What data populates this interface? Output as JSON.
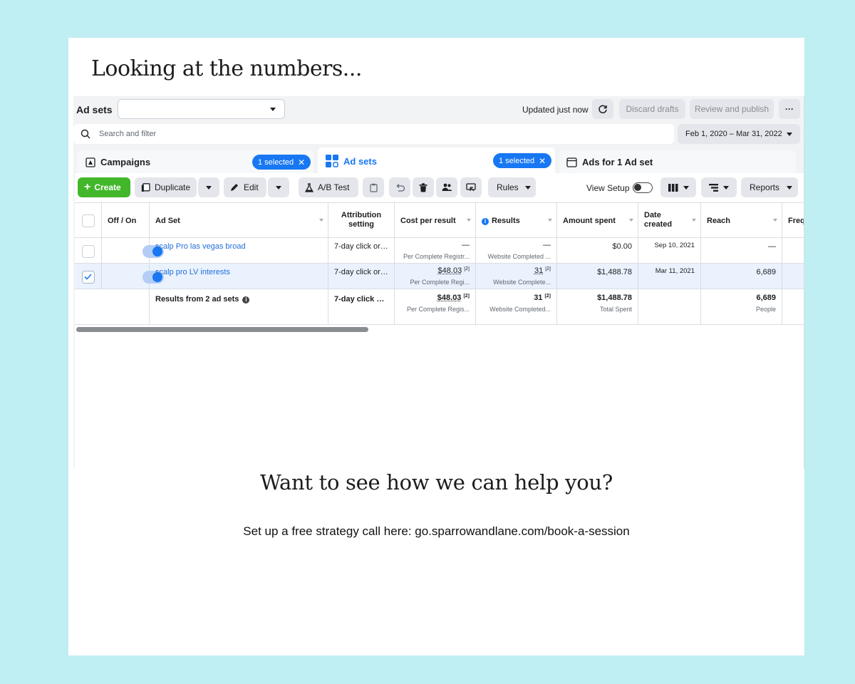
{
  "headline": "Looking at the numbers...",
  "ads_manager": {
    "level_title": "Ad sets",
    "status_text": "Updated just now",
    "discard_label": "Discard drafts",
    "review_label": "Review and publish",
    "more_label": "···",
    "search_placeholder": "Search and filter",
    "date_range": "Feb 1, 2020 – Mar 31, 2022",
    "tabs": [
      {
        "label": "Campaigns",
        "badge": "1 selected"
      },
      {
        "label": "Ad sets",
        "badge": "1 selected"
      },
      {
        "label": "Ads for 1 Ad set"
      }
    ],
    "toolbar": {
      "create_label": "Create",
      "duplicate_label": "Duplicate",
      "edit_label": "Edit",
      "abtest_label": "A/B Test",
      "rules_label": "Rules",
      "view_setup_label": "View Setup",
      "reports_label": "Reports"
    },
    "columns": {
      "off_on": "Off / On",
      "ad_set": "Ad Set",
      "attribution": "Attribution setting",
      "cost_per_result": "Cost per result",
      "results": "Results",
      "amount_spent": "Amount spent",
      "date_created": "Date created",
      "reach": "Reach",
      "frequency": "Frequency"
    },
    "rows": [
      {
        "name": "scalp Pro las vegas broad",
        "attribution": "7-day click or ...",
        "cost": "—",
        "cost_sub": "Per Complete Registr...",
        "results": "—",
        "results_sub": "Website Completed ...",
        "spent": "$0.00",
        "date": "Sep 10, 2021",
        "reach": "—",
        "selected": false,
        "on": true
      },
      {
        "name": "scalp pro LV interests",
        "attribution": "7-day click or ...",
        "cost": "$48.03",
        "cost_sub": "Per Complete Regi...",
        "results": "31",
        "results_sub": "Website Complete...",
        "spent": "$1,488.78",
        "date": "Mar 11, 2021",
        "reach": "6,689",
        "selected": true,
        "on": true
      }
    ],
    "summary": {
      "label": "Results from 2 ad sets",
      "attribution": "7-day click or ...",
      "cost": "$48.03",
      "cost_sub": "Per Complete Regis...",
      "results": "31",
      "results_sub": "Website Completed...",
      "spent": "$1,488.78",
      "spent_sub": "Total Spent",
      "reach": "6,689",
      "reach_sub": "People"
    },
    "footnote_marker": "[2]"
  },
  "cta": {
    "title": "Want to see how we can help you?",
    "subtitle": "Set up a free strategy call here: go.sparrowandlane.com/book-a-session"
  },
  "colors": {
    "page_bg": "#bfeef3",
    "accent_blue": "#1877f2",
    "create_green": "#42b72a"
  }
}
